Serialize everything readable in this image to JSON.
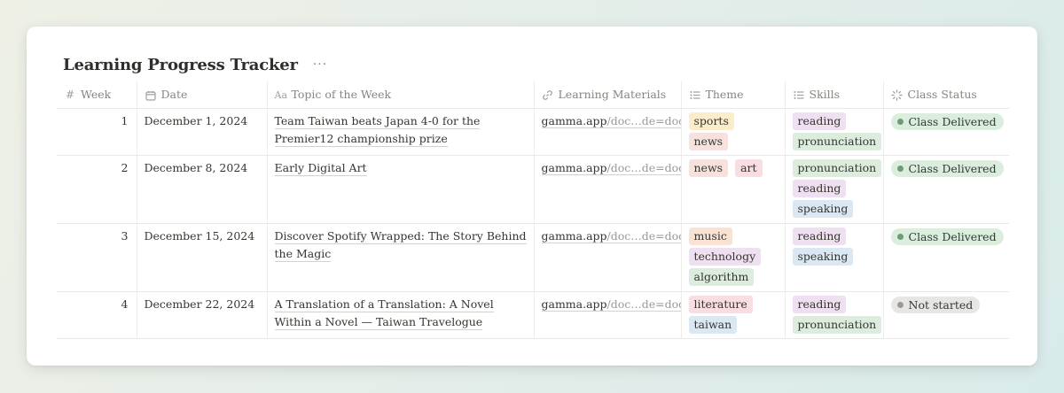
{
  "title": "Learning Progress Tracker",
  "more_label": "···",
  "columns": {
    "week": "Week",
    "date": "Date",
    "topic": "Topic of the Week",
    "materials": "Learning Materials",
    "theme": "Theme",
    "skills": "Skills",
    "status": "Class Status"
  },
  "rows": [
    {
      "week": "1",
      "date": "December 1, 2024",
      "topic": "Team Taiwan beats Japan 4-0 for the Premier12 championship prize",
      "material_host": "gamma.app",
      "material_path": "/doc…de=doc",
      "themes": [
        {
          "label": "sports",
          "color": "#fbeccc"
        },
        {
          "label": "news",
          "color": "#f6e1dd"
        }
      ],
      "skills": [
        {
          "label": "reading",
          "color": "#eee0f1"
        },
        {
          "label": "pronunciation",
          "color": "#dcedde"
        }
      ],
      "status": {
        "label": "Class Delivered",
        "bg": "#dbeddd",
        "dot": "#6e9b78"
      }
    },
    {
      "week": "2",
      "date": "December 8, 2024",
      "topic": "Early Digital Art",
      "material_host": "gamma.app",
      "material_path": "/doc…de=doc",
      "themes": [
        {
          "label": "news",
          "color": "#f6e1dd"
        },
        {
          "label": "art",
          "color": "#f9dde2"
        }
      ],
      "skills": [
        {
          "label": "pronunciation",
          "color": "#dcedde"
        },
        {
          "label": "reading",
          "color": "#eee0f1"
        },
        {
          "label": "speaking",
          "color": "#d9e8f3"
        }
      ],
      "status": {
        "label": "Class Delivered",
        "bg": "#dbeddd",
        "dot": "#6e9b78"
      }
    },
    {
      "week": "3",
      "date": "December 15, 2024",
      "topic": "Discover Spotify Wrapped: The Story Behind the Magic",
      "material_host": "gamma.app",
      "material_path": "/doc…de=doc",
      "themes": [
        {
          "label": "music",
          "color": "#fae2d2"
        },
        {
          "label": "technology",
          "color": "#eee0f1"
        },
        {
          "label": "algorithm",
          "color": "#dcedde"
        }
      ],
      "skills": [
        {
          "label": "reading",
          "color": "#eee0f1"
        },
        {
          "label": "speaking",
          "color": "#d9e8f3"
        }
      ],
      "status": {
        "label": "Class Delivered",
        "bg": "#dbeddd",
        "dot": "#6e9b78"
      }
    },
    {
      "week": "4",
      "date": "December 22, 2024",
      "topic": "A Translation of a Translation: A Novel Within a Novel — Taiwan Travelogue",
      "material_host": "gamma.app",
      "material_path": "/doc…de=doc",
      "themes": [
        {
          "label": "literature",
          "color": "#f9dde2"
        },
        {
          "label": "taiwan",
          "color": "#d9e8f3"
        }
      ],
      "skills": [
        {
          "label": "reading",
          "color": "#eee0f1"
        },
        {
          "label": "pronunciation",
          "color": "#dcedde"
        }
      ],
      "status": {
        "label": "Not started",
        "bg": "#e7e6e3",
        "dot": "#999894"
      }
    }
  ]
}
